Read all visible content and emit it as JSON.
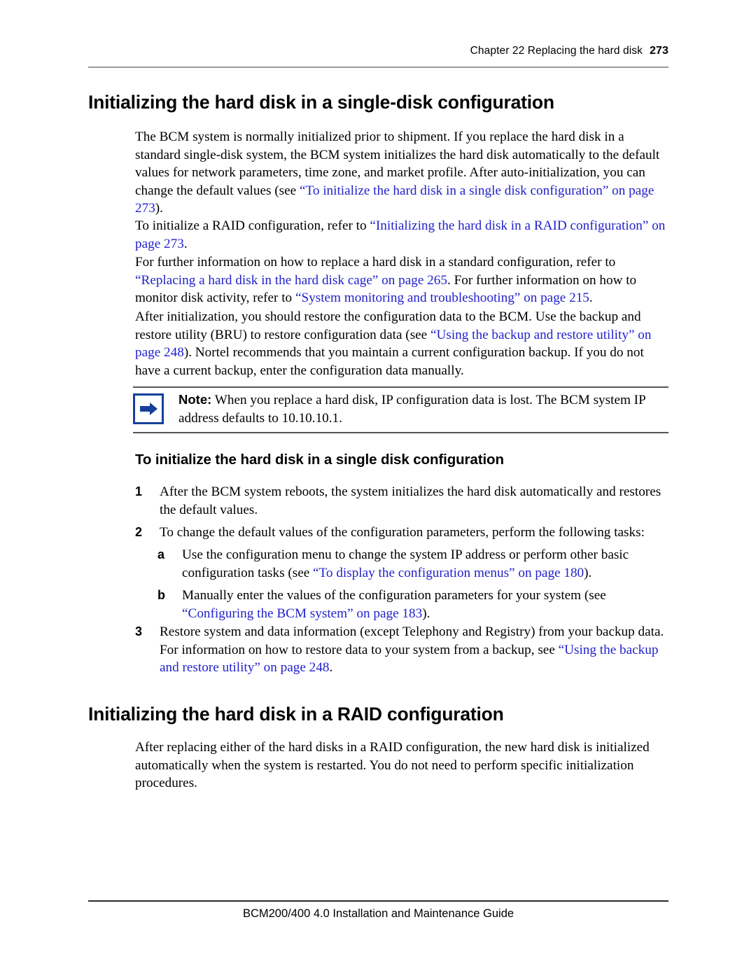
{
  "header": {
    "chapter": "Chapter 22  Replacing the hard disk",
    "page_number": "273"
  },
  "footer": {
    "guide_title": "BCM200/400 4.0 Installation and Maintenance Guide"
  },
  "colors": {
    "link": "#2222cc",
    "note_border": "#15409a",
    "header_rule": "#9a9a9a",
    "footer_rule": "#2b2b2b"
  },
  "section_single_disk": {
    "heading": "Initializing the hard disk in a single-disk configuration",
    "paragraph_1": {
      "part_1": "The BCM system is normally initialized prior to shipment. If you replace the hard disk in a standard single-disk system, the BCM system initializes the hard disk automatically to the default values for network parameters, time zone, and market profile. After auto-initialization, you can change the default values (see ",
      "link_1": "“To initialize the hard disk in a single disk configuration” on page 273",
      "part_2": ")."
    },
    "paragraph_2": {
      "part_1": "To initialize a RAID configuration, refer to ",
      "link_1": "“Initializing the hard disk in a RAID configuration” on page 273",
      "part_2": "."
    },
    "paragraph_3": {
      "part_1": "For further information on how to replace a hard disk in a standard configuration, refer to ",
      "link_1": "“Replacing a hard disk in the hard disk cage” on page 265",
      "part_2": ". For further information on how to monitor disk activity, refer to ",
      "link_2": "“System monitoring and troubleshooting” on page 215",
      "part_3": "."
    },
    "paragraph_4": {
      "part_1": "After initialization, you should restore the configuration data to the BCM. Use the backup and restore utility (BRU) to restore configuration data (see ",
      "link_1": "“Using the backup and restore utility” on page 248",
      "part_2": "). Nortel recommends that you maintain a current configuration backup. If you do not have a current backup, enter the configuration data manually."
    },
    "note": {
      "icon": "blue-arrow-icon",
      "label": "Note:",
      "text": "When you replace a hard disk, IP configuration data is lost. The BCM system IP address defaults to 10.10.10.1."
    },
    "subheading": "To initialize the hard disk in a single disk configuration",
    "steps": [
      {
        "marker": "1",
        "text": "After the BCM system reboots, the system initializes the hard disk automatically and restores the default values."
      },
      {
        "marker": "2",
        "text": "To change the default values of the configuration parameters, perform the following tasks:"
      },
      {
        "marker": "a",
        "part_1": "Use the configuration menu to change the system IP address or perform other basic configuration tasks (see ",
        "link_1": "“To display the configuration menus” on page 180",
        "part_2": ")."
      },
      {
        "marker": "b",
        "part_1": "Manually enter the values of the configuration parameters for your system (see ",
        "link_1": "“Configuring the BCM system” on page 183",
        "part_2": ")."
      },
      {
        "marker": "3",
        "part_1": "Restore system and data information (except Telephony and Registry) from your backup data. For information on how to restore data to your system from a backup, see ",
        "link_1": "“Using the backup and restore utility” on page 248",
        "part_2": "."
      }
    ]
  },
  "section_raid": {
    "heading": "Initializing the hard disk in a RAID configuration",
    "paragraph_1": "After replacing either of the hard disks in a RAID configuration, the new hard disk is initialized automatically when the system is restarted. You do not need to perform specific initialization procedures."
  }
}
